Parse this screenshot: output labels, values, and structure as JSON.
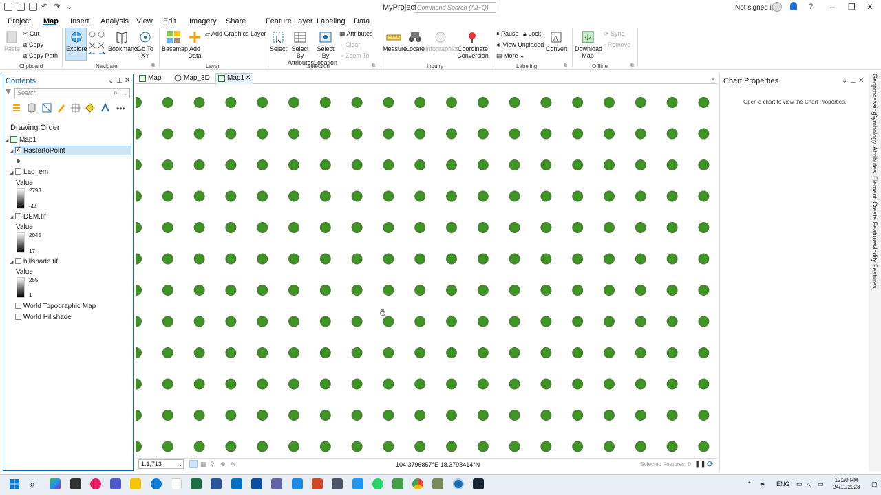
{
  "app": {
    "project_title": "MyProject",
    "command_search_placeholder": "Command Search (Alt+Q)",
    "signin": "Not signed in",
    "help": "?"
  },
  "ribbon_tabs": [
    "Project",
    "Map",
    "Insert",
    "Analysis",
    "View",
    "Edit",
    "Imagery",
    "Share",
    "Feature Layer",
    "Labeling",
    "Data"
  ],
  "active_tab": "Map",
  "ribbon": {
    "clipboard": {
      "paste": "Paste",
      "cut": "Cut",
      "copy": "Copy",
      "copy_path": "Copy Path",
      "label": "Clipboard"
    },
    "navigate": {
      "explore": "Explore",
      "bookmarks": "Bookmarks",
      "go_to_xy": "Go To XY",
      "label": "Navigate"
    },
    "layer": {
      "basemap": "Basemap",
      "add_data": "Add Data",
      "add_graphics_layer": "Add Graphics Layer",
      "label": "Layer"
    },
    "selection": {
      "select": "Select",
      "select_by_attributes": "Select By Attributes",
      "select_by_location": "Select By Location",
      "attributes": "Attributes",
      "clear": "Clear",
      "zoom_to": "Zoom To",
      "label": "Selection"
    },
    "inquiry": {
      "measure": "Measure",
      "locate": "Locate",
      "infographics": "Infographics",
      "coordinate_conversion": "Coordinate Conversion",
      "label": "Inquiry"
    },
    "labeling": {
      "pause": "Pause",
      "lock": "Lock",
      "view_unplaced": "View Unplaced",
      "more": "More",
      "convert": "Convert",
      "label": "Labeling"
    },
    "offline": {
      "download_map": "Download Map",
      "sync": "Sync",
      "remove": "Remove",
      "label": "Offline"
    }
  },
  "contents": {
    "title": "Contents",
    "search_placeholder": "Search",
    "drawing_order": "Drawing Order",
    "map_name": "Map1",
    "layers": [
      {
        "name": "RastertoPoint",
        "checked": true
      },
      {
        "name": "Lao_em",
        "checked": false,
        "legend_title": "Value",
        "max": "2793",
        "min": "-44"
      },
      {
        "name": "DEM.tif",
        "checked": false,
        "legend_title": "Value",
        "max": "2045",
        "min": "17"
      },
      {
        "name": "hillshade.tif",
        "checked": false,
        "legend_title": "Value",
        "max": "255",
        "min": "1"
      },
      {
        "name": "World Topographic Map",
        "checked": false
      },
      {
        "name": "World Hillshade",
        "checked": false
      }
    ]
  },
  "map_tabs": [
    "Map",
    "Map_3D",
    "Map1"
  ],
  "active_map_tab": "Map1",
  "map": {
    "point_rows": 12,
    "point_cols": 19,
    "point_color": "#3a9a1e",
    "point_outline": "#2a6e12"
  },
  "status": {
    "scale": "1:1,713",
    "coordinates": "104.3796857°E 18.3798414°N",
    "selected_features": "Selected Features: 0"
  },
  "chart_properties": {
    "title": "Chart Properties",
    "message": "Open a chart to view the Chart Properties."
  },
  "side_tabs": [
    "Geoprocessing",
    "Symbology",
    "Attributes",
    "Element",
    "Create Features",
    "Modify Features"
  ],
  "taskbar": {
    "language": "ENG",
    "time": "12:20 PM",
    "date": "24/11/2023"
  },
  "colors": {
    "accent": "#0c6abf",
    "selection": "#cde6f7"
  }
}
